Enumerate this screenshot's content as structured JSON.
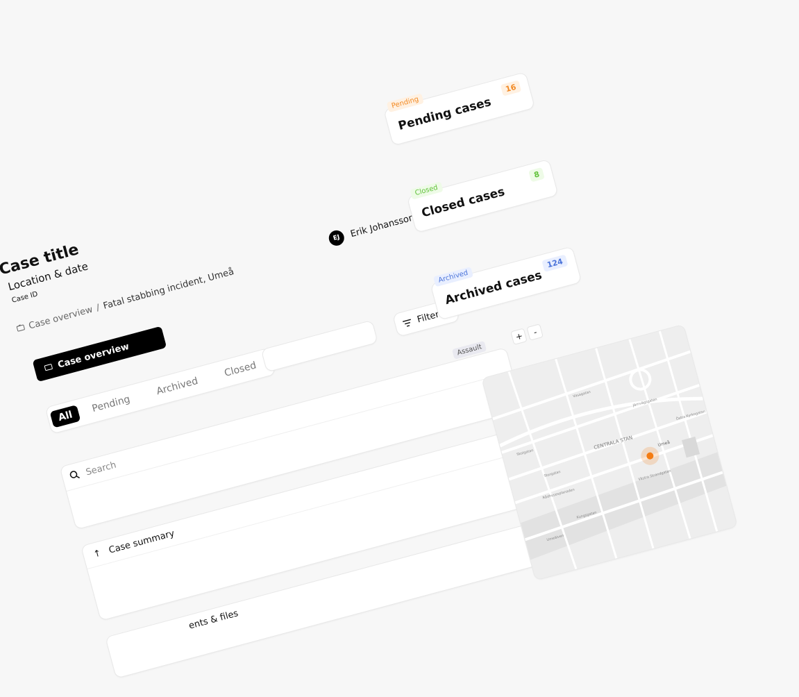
{
  "header": {
    "title": "Case title",
    "subtitle": "Location & date",
    "case_id_label": "Case ID"
  },
  "breadcrumb": {
    "root": "Case overview",
    "separator": "/",
    "current": "Fatal stabbing incident, Umeå"
  },
  "user": {
    "initials": "EJ",
    "name": "Erik Johansson"
  },
  "nav": {
    "case_overview_button": "Case overview"
  },
  "tabs": [
    {
      "label": "All",
      "active": true
    },
    {
      "label": "Pending",
      "active": false
    },
    {
      "label": "Archived",
      "active": false
    },
    {
      "label": "Closed",
      "active": false
    }
  ],
  "filters": {
    "label": "Filters"
  },
  "search": {
    "placeholder": "Search"
  },
  "sections": {
    "case_summary": "Case summary",
    "documents_files": "ents & files"
  },
  "status_cards": [
    {
      "chip": "Pending",
      "title": "Pending cases",
      "count": "16",
      "color": "#f28a24",
      "bg": "#fff1e2"
    },
    {
      "chip": "Closed",
      "title": "Closed cases",
      "count": "8",
      "color": "#61c23a",
      "bg": "#eefbe7"
    },
    {
      "chip": "Archived",
      "title": "Archived cases",
      "count": "124",
      "color": "#4a73d9",
      "bg": "#e9efff"
    }
  ],
  "map": {
    "tag": "Assault",
    "zoom_in": "+",
    "zoom_out": "-",
    "labels": {
      "district": "CENTRALA STAN",
      "city": "Umeå",
      "river": "Umeälven",
      "street_1": "Skolgatan",
      "street_2": "Storgatan",
      "street_3": "Västra Strandgatan",
      "street_4": "Rådhusesplanaden",
      "street_5": "Kungsgatan",
      "street_6": "Järnvägsgatan",
      "street_7": "Vasagatan",
      "street_8": "Östra Kyrkogatan"
    },
    "marker_color": "#f47c12"
  },
  "colors": {
    "accent": "#000000",
    "background": "#f7f7f7"
  }
}
